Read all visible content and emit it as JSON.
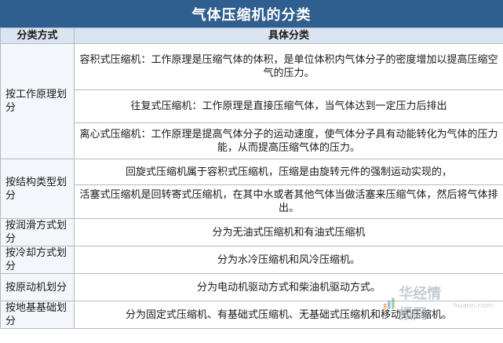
{
  "title": "气体压缩机的分类",
  "header": {
    "col1": "分类方式",
    "col2": "具体分类"
  },
  "groups": [
    {
      "category": "按工作原理划分",
      "items": [
        "容积式压缩机：工作原理是压缩气体的体积，是单位体积内气体分子的密度增加以提高压缩空气的压力。",
        "往复式压缩机：工作原理是直接压缩气体，当气体达到一定压力后排出",
        "离心式压缩机：工作原理是提高气体分子的运动速度，使气体分子具有动能转化为气体的压力能，从而提高压缩气体的压力。"
      ]
    },
    {
      "category": "按结构类型划分",
      "items": [
        "回旋式压缩机属于容积式压缩机，压缩是由旋转元件的强制运动实现的，",
        "活塞式压缩机是回转寄式压缩机，在其中水或者其他气体当做活塞来压缩气体，然后将气体排出。"
      ]
    },
    {
      "category": "按润滑方式划分",
      "items": [
        "分为无油式压缩机和有油式压缩机"
      ]
    },
    {
      "category": "按冷却方式划分",
      "items": [
        "分为水冷压缩机和风冷压缩机。"
      ]
    },
    {
      "category": "按原动机划分",
      "items": [
        "分为电动机驱动方式和柴油机驱动方式。"
      ]
    },
    {
      "category": "按地基基础划分",
      "items": [
        "分为固定式压缩机、有基础式压缩机、无基础式压缩机和移动式压缩机。"
      ]
    }
  ],
  "watermark": {
    "text": "华经情报网",
    "domain": "huaon.com"
  }
}
